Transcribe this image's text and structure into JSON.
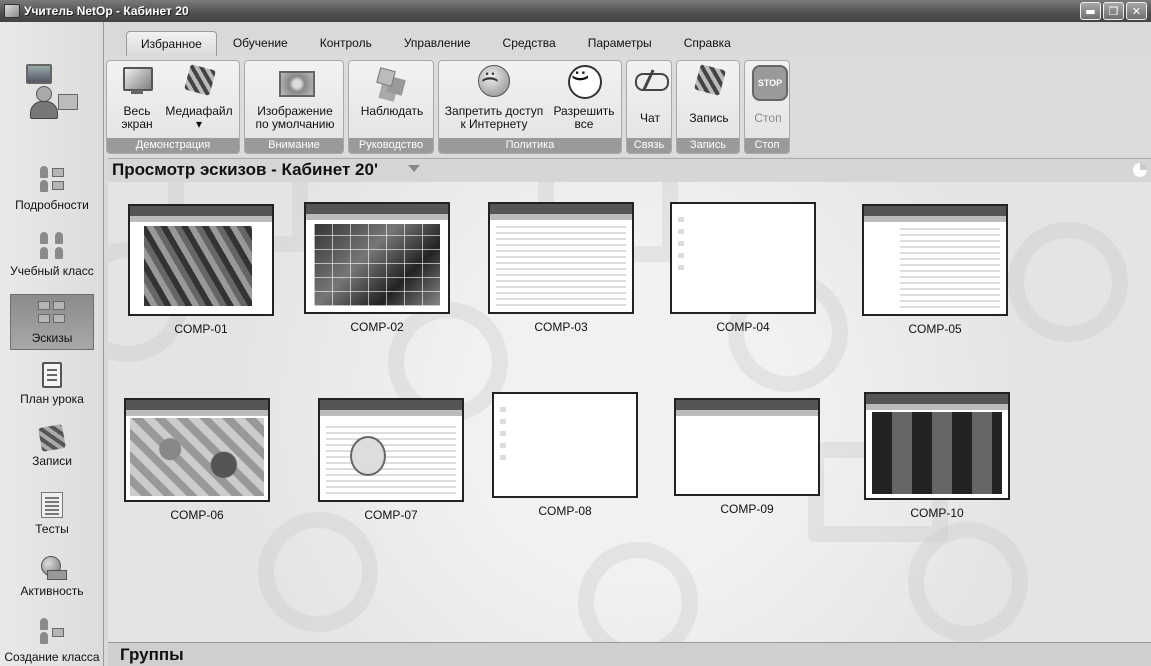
{
  "window": {
    "title": "Учитель NetOp - Кабинет 20",
    "buttons": {
      "minimize": "▬",
      "restore": "❐",
      "close": "✕"
    }
  },
  "menu_tabs": [
    "Избранное",
    "Обучение",
    "Контроль",
    "Управление",
    "Средства",
    "Параметры",
    "Справка"
  ],
  "active_tab": "Избранное",
  "ribbon": {
    "groups": [
      {
        "label": "Демонстрация",
        "buttons": [
          {
            "label": "Весь\nэкран",
            "icon": "monitor-icon"
          },
          {
            "label": "Медиафайл\n▾",
            "icon": "media-file-icon"
          }
        ]
      },
      {
        "label": "Внимание",
        "buttons": [
          {
            "label": "Изображение\nпо умолчанию",
            "icon": "picture-icon"
          }
        ]
      },
      {
        "label": "Руководство",
        "buttons": [
          {
            "label": "Наблюдать",
            "icon": "observe-icon"
          }
        ]
      },
      {
        "label": "Политика",
        "buttons": [
          {
            "label": "Запретить доступ\nк Интернету",
            "icon": "sad-face-icon"
          },
          {
            "label": "Разрешить\nвсе",
            "icon": "smile-face-icon"
          }
        ]
      },
      {
        "label": "Связь",
        "buttons": [
          {
            "label": "Чат",
            "icon": "chat-icon"
          }
        ]
      },
      {
        "label": "Запись",
        "buttons": [
          {
            "label": "Запись",
            "icon": "record-icon"
          }
        ]
      },
      {
        "label": "Стоп",
        "buttons": [
          {
            "label": "Стоп",
            "icon": "stop-icon",
            "disabled": true
          }
        ]
      }
    ]
  },
  "sidebar": {
    "items": [
      {
        "label": "Подробности",
        "icon": "details-icon"
      },
      {
        "label": "Учебный класс",
        "icon": "classroom-icon"
      },
      {
        "label": "Эскизы",
        "icon": "thumbnails-icon",
        "selected": true
      },
      {
        "label": "План урока",
        "icon": "lesson-plan-icon"
      },
      {
        "label": "Записи",
        "icon": "recordings-icon"
      },
      {
        "label": "Тесты",
        "icon": "tests-icon"
      },
      {
        "label": "Активность",
        "icon": "activity-icon"
      },
      {
        "label": "Создание класса",
        "icon": "create-class-icon"
      }
    ]
  },
  "view": {
    "title": "Просмотр эскизов - Кабинет 20'",
    "thumbnails": [
      "COMP-01",
      "COMP-02",
      "COMP-03",
      "COMP-04",
      "COMP-05",
      "COMP-06",
      "COMP-07",
      "COMP-08",
      "COMP-09",
      "COMP-10"
    ]
  },
  "footer": {
    "title": "Группы"
  }
}
